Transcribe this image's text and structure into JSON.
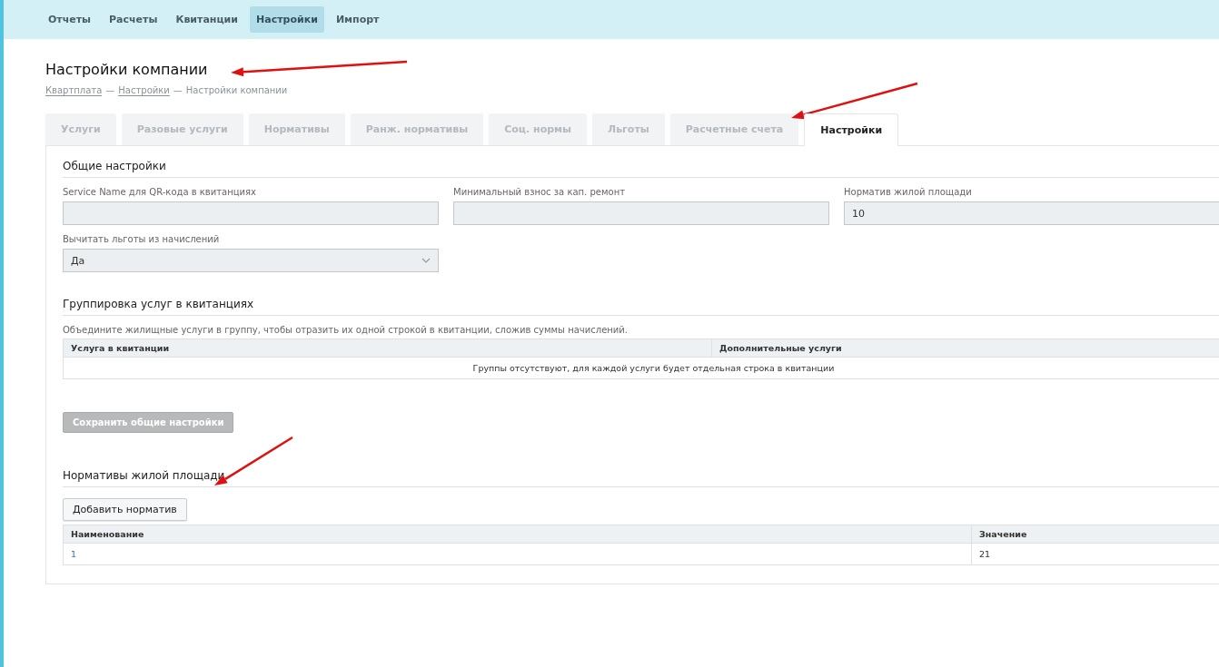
{
  "nav": [
    {
      "label": "Отчеты",
      "selected": false
    },
    {
      "label": "Расчеты",
      "selected": false
    },
    {
      "label": "Квитанции",
      "selected": false
    },
    {
      "label": "Настройки",
      "selected": true
    },
    {
      "label": "Импорт",
      "selected": false
    }
  ],
  "page_title": "Настройки компании",
  "breadcrumbs": [
    {
      "label": "Квартплата",
      "kind": "link"
    },
    {
      "label": "—",
      "kind": "separator"
    },
    {
      "label": "Настройки",
      "kind": "link"
    },
    {
      "label": "—",
      "kind": "separator"
    },
    {
      "label": "Настройки компании",
      "kind": "current"
    }
  ],
  "tabs": [
    {
      "label": "Услуги",
      "selected": false
    },
    {
      "label": "Разовые услуги",
      "selected": false
    },
    {
      "label": "Нормативы",
      "selected": false
    },
    {
      "label": "Ранж. нормативы",
      "selected": false
    },
    {
      "label": "Соц. нормы",
      "selected": false
    },
    {
      "label": "Льготы",
      "selected": false
    },
    {
      "label": "Расчетные счета",
      "selected": false
    },
    {
      "label": "Настройки",
      "selected": true
    }
  ],
  "general_settings": {
    "title": "Общие настройки",
    "fields": [
      {
        "label": "Service Name для QR-кода в квитанциях",
        "kind": "input"
      },
      {
        "label": "Минимальный взнос за кап. ремонт",
        "kind": "input"
      },
      {
        "label": "Норматив жилой площади",
        "value": "10",
        "kind": "input"
      },
      {
        "label": "Вычитать льготы из начислений",
        "value": "Да",
        "kind": "select"
      }
    ]
  },
  "grouping": {
    "title": "Группировка услуг в квитанциях",
    "hint": "Объедините жилищные услуги в группу, чтобы отразить их одной строкой в квитанции, сложив суммы начислений.",
    "columns": [
      "Услуга в квитанции",
      "Дополнительные услуги"
    ],
    "empty_message": "Группы отсутствуют, для каждой услуги будет отдельная строка в квитанции"
  },
  "save_button": {
    "label": "Сохранить общие настройки",
    "disabled": true
  },
  "norms": {
    "title": "Нормативы жилой площади",
    "add_button": "Добавить норматив",
    "columns": [
      "Наименование",
      "Значение"
    ],
    "rows": [
      [
        "1",
        "21"
      ]
    ]
  }
}
